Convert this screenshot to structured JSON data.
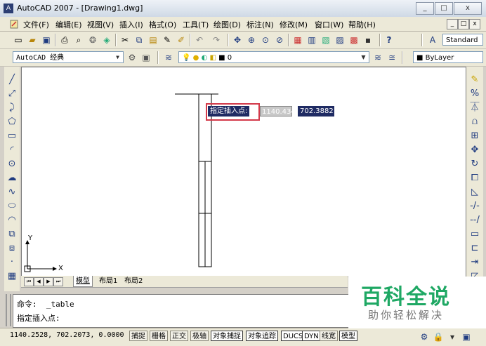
{
  "window": {
    "title": "AutoCAD 2007 - [Drawing1.dwg]",
    "minimize": "_",
    "maximize": "□",
    "close": "x"
  },
  "menu": {
    "items": [
      "文件(F)",
      "编辑(E)",
      "视图(V)",
      "插入(I)",
      "格式(O)",
      "工具(T)",
      "绘图(D)",
      "标注(N)",
      "修改(M)",
      "窗口(W)",
      "帮助(H)"
    ],
    "mdi_min": "_",
    "mdi_max": "□",
    "mdi_close": "x"
  },
  "toolbar1": {
    "style_combo": "Standard"
  },
  "toolbar2": {
    "workspace": "AutoCAD 经典",
    "layer": "0",
    "color": "ByLayer"
  },
  "tooltip": {
    "prompt": "指定插入点:",
    "x_value": "1140.434",
    "y_value": "702.3882"
  },
  "ucs": {
    "x_label": "X",
    "y_label": "Y"
  },
  "tabs": {
    "model": "模型",
    "layout1": "布局1",
    "layout2": "布局2"
  },
  "command": {
    "line1": "命令:  _table",
    "line2": "指定插入点:"
  },
  "status": {
    "coords": "1140.2528, 702.2073, 0.0000",
    "buttons": [
      "捕捉",
      "栅格",
      "正交",
      "极轴",
      "对象捕捉",
      "对象追踪",
      "DUCS",
      "DYN",
      "线宽",
      "模型"
    ]
  },
  "watermark": {
    "title": "百科全说",
    "subtitle": "助你轻松解决"
  },
  "colors": {
    "tooltip_bg": "#1f2b63",
    "highlight": "#d33a4a",
    "watermark_green": "#1fa864"
  }
}
